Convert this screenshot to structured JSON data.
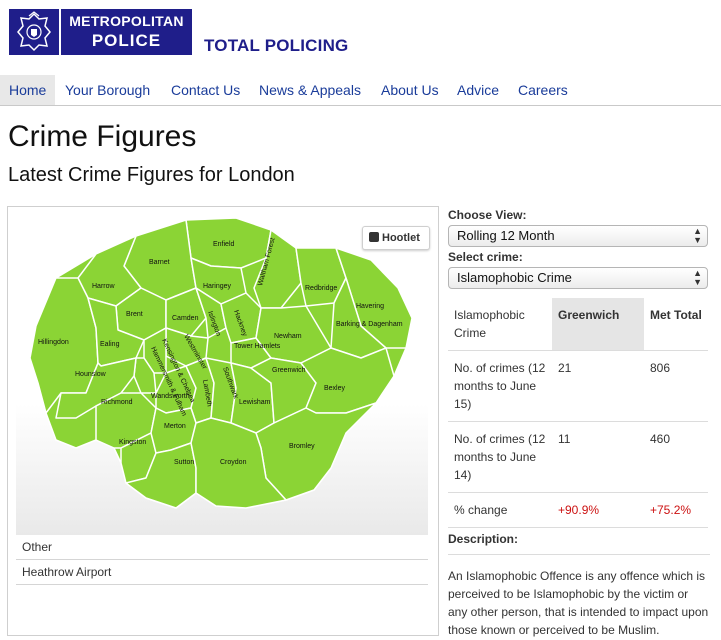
{
  "header": {
    "logo_line1": "METROPOLITAN",
    "logo_line2": "POLICE",
    "tagline": "TOTAL POLICING",
    "brand_color": "#1f1e8a"
  },
  "nav": {
    "items": [
      {
        "label": "Home",
        "active": true
      },
      {
        "label": "Your Borough"
      },
      {
        "label": "Contact Us"
      },
      {
        "label": "News & Appeals"
      },
      {
        "label": "About Us"
      },
      {
        "label": "Advice"
      },
      {
        "label": "Careers"
      }
    ]
  },
  "page": {
    "title": "Crime Figures",
    "subtitle": "Latest Crime Figures for London"
  },
  "map": {
    "badge": "Hootlet",
    "fill_color": "#8bd435",
    "boroughs": [
      "Enfield",
      "Barnet",
      "Harrow",
      "Haringey",
      "Waltham Forest",
      "Redbridge",
      "Havering",
      "Brent",
      "Camden",
      "Islington",
      "Hackney",
      "Barking & Dagenham",
      "Hillingdon",
      "Ealing",
      "Westminster",
      "Kensington & Chelsea",
      "Hammersmith & Fulham",
      "Tower Hamlets",
      "Newham",
      "Hounslow",
      "Greenwich",
      "Southwark",
      "Lambeth",
      "Bexley",
      "Richmond",
      "Wandsworth",
      "Lewisham",
      "Kingston",
      "Merton",
      "Bromley",
      "Sutton",
      "Croydon"
    ],
    "rows": [
      "Other",
      "Heathrow Airport"
    ]
  },
  "controls": {
    "view_label": "Choose View:",
    "view_value": "Rolling 12 Month",
    "crime_label": "Select crime:",
    "crime_value": "Islamophobic Crime"
  },
  "table": {
    "headers": [
      "Islamophobic Crime",
      "Greenwich",
      "Met Total"
    ],
    "rows": [
      {
        "label": "No. of crimes (12 months to June 15)",
        "local": "21",
        "total": "806"
      },
      {
        "label": "No. of crimes (12 months to June 14)",
        "local": "11",
        "total": "460"
      },
      {
        "label": "% change",
        "local": "+90.9%",
        "total": "+75.2%"
      }
    ]
  },
  "description": {
    "label": "Description:",
    "text": "An Islamophobic Offence is any offence which is perceived to be Islamophobic by the victim or any other person, that is intended to impact upon those known or perceived to be Muslim."
  }
}
